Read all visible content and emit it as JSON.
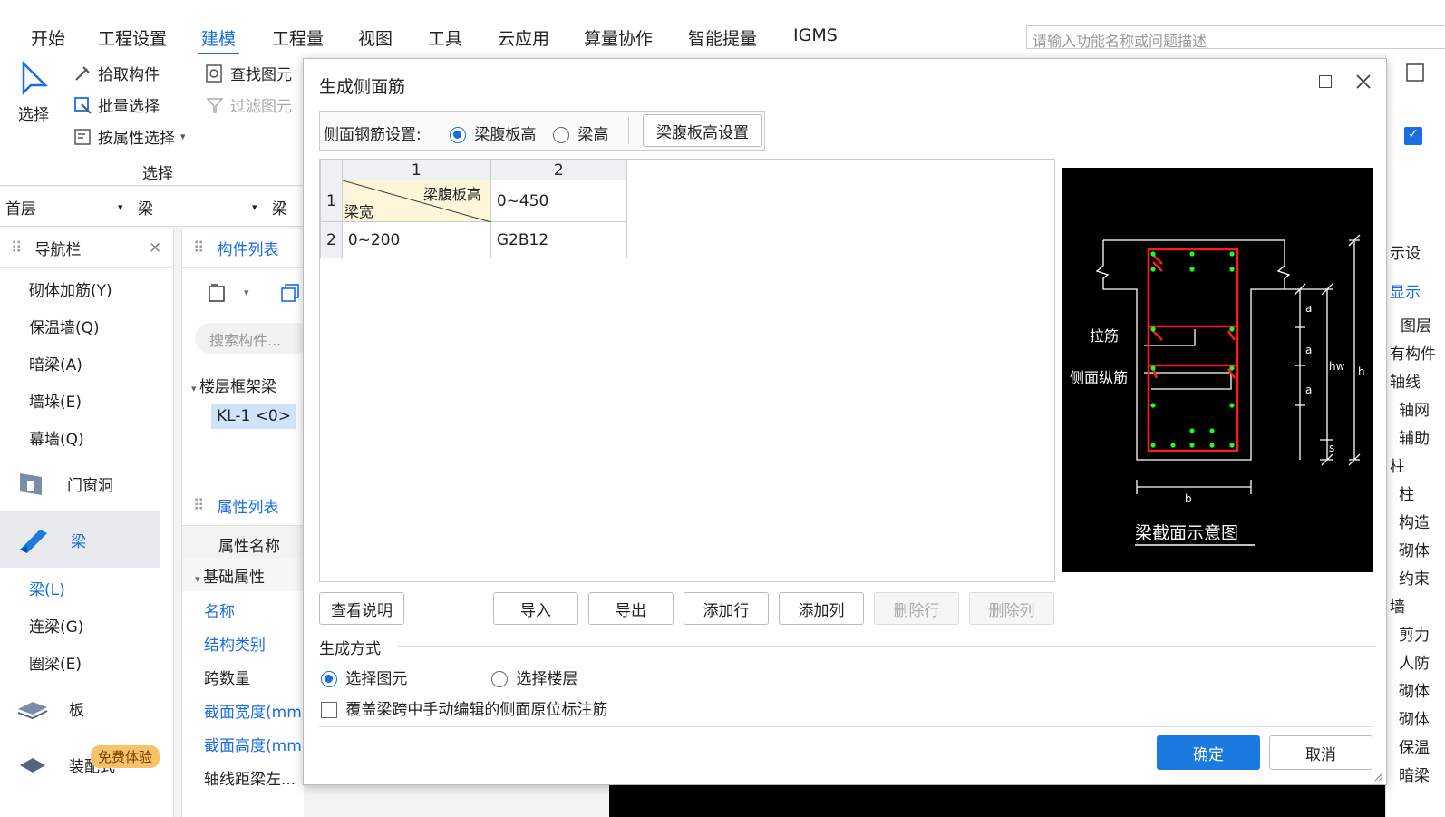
{
  "menu": {
    "tabs": [
      "开始",
      "工程设置",
      "建模",
      "工程量",
      "视图",
      "工具",
      "云应用",
      "算量协作",
      "智能提量",
      "IGMS"
    ],
    "active_index": 2,
    "search_placeholder": "请输入功能名称或问题描述"
  },
  "ribbon": {
    "select_label": "选择",
    "pick_component": "拾取构件",
    "batch_select": "批量选择",
    "attr_select": "按属性选择",
    "find_element": "查找图元",
    "filter_element": "过滤图元",
    "group_label": "选择"
  },
  "combos": {
    "floor": "首层",
    "type": "梁",
    "type2": "梁"
  },
  "nav": {
    "title": "导航栏",
    "items_top": [
      "砌体加筋(Y)",
      "保温墙(Q)",
      "暗梁(A)",
      "墙垛(E)",
      "幕墙(Q)"
    ],
    "cat_door": "门窗洞",
    "cat_beam": "梁",
    "beam_items": [
      "梁(L)",
      "连梁(G)",
      "圈梁(E)"
    ],
    "cat_slab": "板",
    "cat_deco": "装配式",
    "free_badge": "免费体验"
  },
  "components": {
    "title": "构件列表",
    "search_placeholder": "搜索构件...",
    "group": "楼层框架梁",
    "item": "KL-1 <0>",
    "props_title": "属性列表",
    "props_header": "属性名称",
    "props_group": "基础属性",
    "props": [
      "名称",
      "结构类别",
      "跨数量",
      "截面宽度(mm",
      "截面高度(mm",
      "轴线距梁左..."
    ]
  },
  "right": {
    "items": [
      "示设",
      "显示",
      "图层",
      "有构件",
      "轴线",
      "轴网",
      "辅助",
      "柱",
      "柱",
      "构造",
      "砌体",
      "约束",
      "墙",
      "剪力",
      "人防",
      "砌体",
      "砌体",
      "保温",
      "暗梁"
    ]
  },
  "dialog": {
    "title": "生成侧面筋",
    "setting_label": "侧面钢筋设置:",
    "opt_web_height": "梁腹板高",
    "opt_beam_height": "梁高",
    "web_height_setting_btn": "梁腹板高设置",
    "table": {
      "col_headers": [
        "1",
        "2"
      ],
      "corner_top": "梁腹板高",
      "corner_bottom": "梁宽",
      "rows": [
        {
          "num": "1",
          "c2": "0~450"
        },
        {
          "num": "2",
          "c1": "0~200",
          "c2": "G2B12"
        }
      ]
    },
    "preview": {
      "title": "梁截面示意图",
      "label_tie": "拉筋",
      "label_side": "侧面纵筋",
      "dim_a": "a",
      "dim_hw": "hw",
      "dim_h": "h",
      "dim_s": "s",
      "dim_b": "b"
    },
    "buttons": {
      "view_help": "查看说明",
      "import": "导入",
      "export": "导出",
      "add_row": "添加行",
      "add_col": "添加列",
      "del_row": "删除行",
      "del_col": "删除列"
    },
    "gen_title": "生成方式",
    "opt_select_element": "选择图元",
    "opt_select_floor": "选择楼层",
    "overwrite_label": "覆盖梁跨中手动编辑的侧面原位标注筋",
    "ok": "确定",
    "cancel": "取消"
  }
}
